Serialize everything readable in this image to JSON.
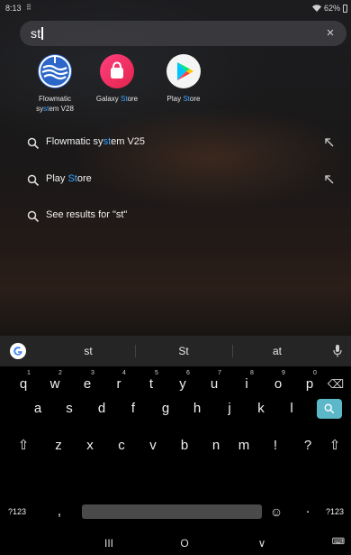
{
  "status_bar": {
    "time": "8:13",
    "grid_icon": "⠿",
    "battery": "62%"
  },
  "search": {
    "query": "st",
    "clear_label": "×"
  },
  "apps": [
    {
      "label_a": "Flowmatic",
      "label_b_pre": "sy",
      "label_b_hl": "st",
      "label_b_post": "em V28",
      "icon": "flowmatic-icon"
    },
    {
      "label_pre": "Galaxy ",
      "label_hl": "St",
      "label_post": "ore",
      "icon": "galaxy-store-icon"
    },
    {
      "label_pre": "Play ",
      "label_hl": "St",
      "label_post": "ore",
      "icon": "play-store-icon"
    }
  ],
  "suggestions": [
    {
      "pre": "Flowmatic sy",
      "hl": "st",
      "post": "em V25"
    },
    {
      "pre": "Play ",
      "hl": "St",
      "post": "ore"
    },
    {
      "pre": "See results for \"st\"",
      "hl": "",
      "post": ""
    }
  ],
  "keyboard": {
    "suggestions": [
      "st",
      "St",
      "at"
    ],
    "row1": [
      {
        "k": "q",
        "h": "1"
      },
      {
        "k": "w",
        "h": "2"
      },
      {
        "k": "e",
        "h": "3"
      },
      {
        "k": "r",
        "h": "4"
      },
      {
        "k": "t",
        "h": "5"
      },
      {
        "k": "y",
        "h": "6"
      },
      {
        "k": "u",
        "h": "7"
      },
      {
        "k": "i",
        "h": "8"
      },
      {
        "k": "o",
        "h": "9"
      },
      {
        "k": "p",
        "h": "0"
      }
    ],
    "row2": [
      "a",
      "s",
      "d",
      "f",
      "g",
      "h",
      "j",
      "k",
      "l"
    ],
    "row3": [
      "z",
      "x",
      "c",
      "v",
      "b",
      "n",
      "m",
      "!",
      "?"
    ],
    "symbols_label": "?123",
    "comma": ",",
    "period": "·",
    "symbols_label_right": "?123",
    "shift_glyph": "⇧",
    "backspace_glyph": "⌫",
    "emoji_glyph": "☺",
    "keyboard_glyph": "⌨"
  },
  "nav": {
    "recent": "III",
    "home": "O",
    "back": "∨"
  },
  "colors": {
    "accent": "#3aa5ff",
    "enter_key": "#5cb8c9"
  }
}
